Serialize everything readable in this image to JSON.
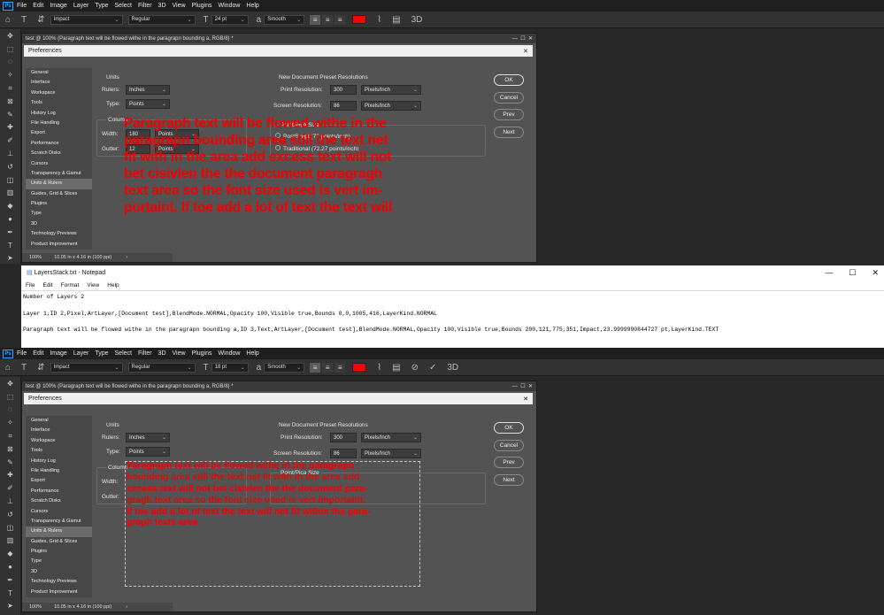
{
  "ps_app": {
    "menu": [
      "File",
      "Edit",
      "Image",
      "Layer",
      "Type",
      "Select",
      "Filter",
      "3D",
      "View",
      "Plugins",
      "Window",
      "Help"
    ],
    "logo": "Ps"
  },
  "top": {
    "font_family": "Impact",
    "font_style": "Regular",
    "font_size": "24 pt",
    "antialias": "Smooth",
    "text_color": "#ff0000",
    "doc_title": "test @ 100% (Paragraph text will be flowed withe in the paragrapn bounding a, RGB/8) *",
    "status_zoom": "100%",
    "status_info": "10.05 in x 4.16 in (100 ppi)",
    "red_text": "Paragraph text will be flowed withe in the\nparagrapn bounding area still the text net\nfit with in the area  add excess text will not\nbet cisivlen the the document paragragh\ntext  area so the font size used is vert im-\nportaint.  If toe add a lot of text the text will"
  },
  "bottom": {
    "font_family": "Impact",
    "font_style": "Regular",
    "font_size": "18 pt",
    "antialias": "Smooth",
    "text_color": "#ff0000",
    "doc_title": "test @ 100% (Paragraph text will be flowed withe in the paragrapn bounding a, RGB/8) *",
    "status_zoom": "100%",
    "status_info": "10.05 in x 4.16 in (100 ppi)",
    "red_text": "Paragraph text will be flowed withe in the paragrapn\nbounding area still the text net fit with in the area  add\nexcess text will not bet cisivlen the the document para-\ngragh text  area so the font size used is vert importaint.\nIf toe add a lot of text the text will not fit within the para-\ngraph texts  area"
  },
  "prefs": {
    "title": "Preferences",
    "nav": [
      "General",
      "Interface",
      "Workspace",
      "Tools",
      "History Log",
      "File Handling",
      "Export",
      "Performance",
      "Scratch Disks",
      "Cursors",
      "Transparency & Gamut",
      "Units & Rulers",
      "Guides, Grid & Slices",
      "Plugins",
      "Type",
      "3D",
      "Technology Previews",
      "Product Improvement"
    ],
    "selected_nav": "Units & Rulers",
    "units_heading": "Units",
    "rulers_label": "Rulers:",
    "rulers_value": "Inches",
    "type_label": "Type:",
    "type_value": "Points",
    "columns_heading": "Column",
    "width_label": "Width:",
    "width_value": "180",
    "width_unit": "Points",
    "gutter_label": "Gutter:",
    "gutter_value": "12",
    "gutter_unit": "Points",
    "preset_heading": "New Document Preset Resolutions",
    "print_res_label": "Print Resolution:",
    "print_res_value": "300",
    "print_res_unit": "Pixels/Inch",
    "screen_res_label": "Screen Resolution:",
    "screen_res_value": "86",
    "screen_res_unit": "Pixels/Inch",
    "pica_heading": "Point/Pica Size",
    "postscript_label": "PostScript (72 points/inch)",
    "traditional_label": "Traditional (72.27 points/inch)",
    "ok": "OK",
    "cancel": "Cancel",
    "prev": "Prev",
    "next": "Next"
  },
  "notepad": {
    "title": "LayersStack.txt - Notepad",
    "menu": [
      "File",
      "Edit",
      "Format",
      "View",
      "Help"
    ],
    "lines": [
      "Number of Layers 2",
      "",
      "Layer 1,ID 2,Pixel,ArtLayer,[Document test],BlendMode.NORMAL,Opacity 100,Visible true,Bounds 0,0,1005,416,LayerKind.NORMAL",
      "",
      "Paragraph text will be flowed withe in the paragrapn bounding a,ID 3,Text,ArtLayer,[Document test],BlendMode.NORMAL,Opacity 100,Visible true,Bounds 200,121,775,351,Impact,23.9999990844727 pt,LayerKind.TEXT"
    ]
  }
}
